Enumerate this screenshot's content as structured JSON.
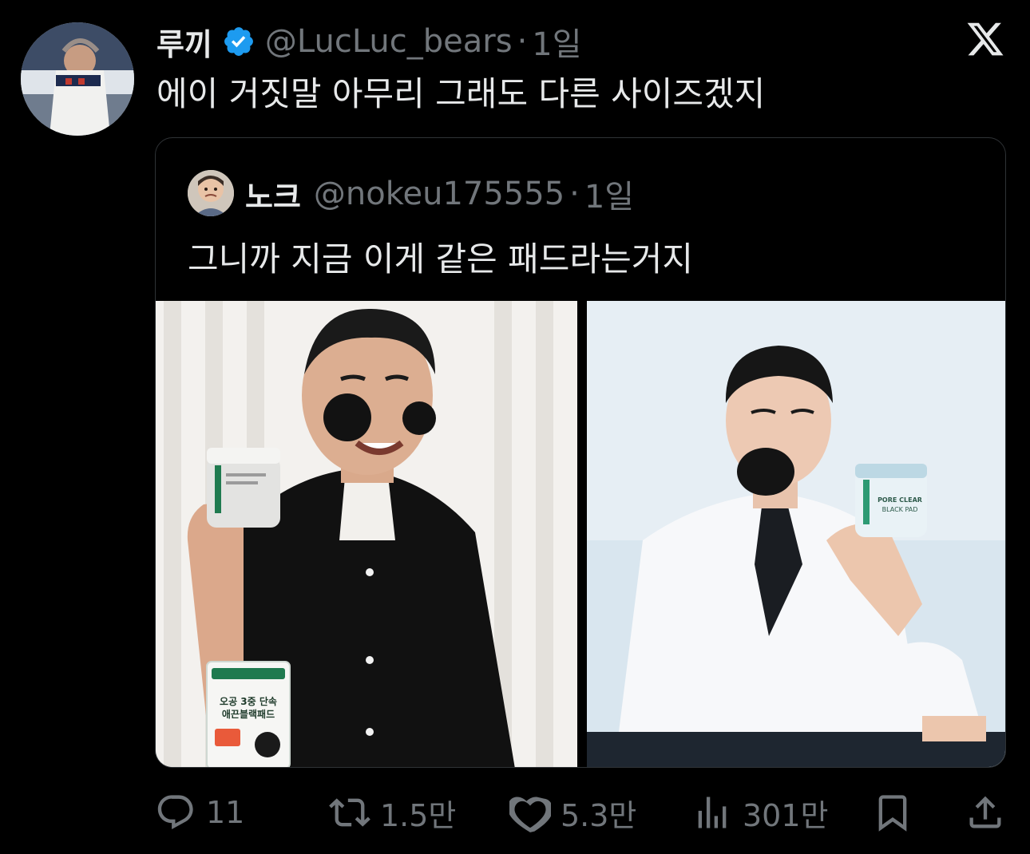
{
  "tweet": {
    "display_name": "루끼",
    "handle": "@LucLuc_bears",
    "separator": "·",
    "time": "1일",
    "text": "에이 거짓말 아무리 그래도 다른 사이즈겠지",
    "verified": true
  },
  "quoted": {
    "display_name": "노크",
    "handle": "@nokeu175555",
    "separator": "·",
    "time": "1일",
    "text": "그니까 지금 이게 같은 패드라는거지",
    "photos": [
      {
        "id": "left",
        "product_text_1": "오공 3중 단속",
        "product_text_2": "애끈블랙패드"
      },
      {
        "id": "right",
        "product_text_1": "PORE CLEAR",
        "product_text_2": "BLACK PAD"
      }
    ]
  },
  "actions": {
    "reply_count": "11",
    "retweet_count": "1.5만",
    "like_count": "5.3만",
    "views_count": "301만"
  },
  "colors": {
    "background": "#000000",
    "text_primary": "#e7e9ea",
    "text_secondary": "#71767b",
    "verified_blue": "#1d9bf0",
    "border": "#2f3336"
  },
  "icons": {
    "platform": "x-logo-icon",
    "verified": "verified-badge-icon",
    "reply": "reply-icon",
    "retweet": "retweet-icon",
    "like": "heart-icon",
    "views": "views-icon",
    "bookmark": "bookmark-icon",
    "share": "share-icon"
  }
}
